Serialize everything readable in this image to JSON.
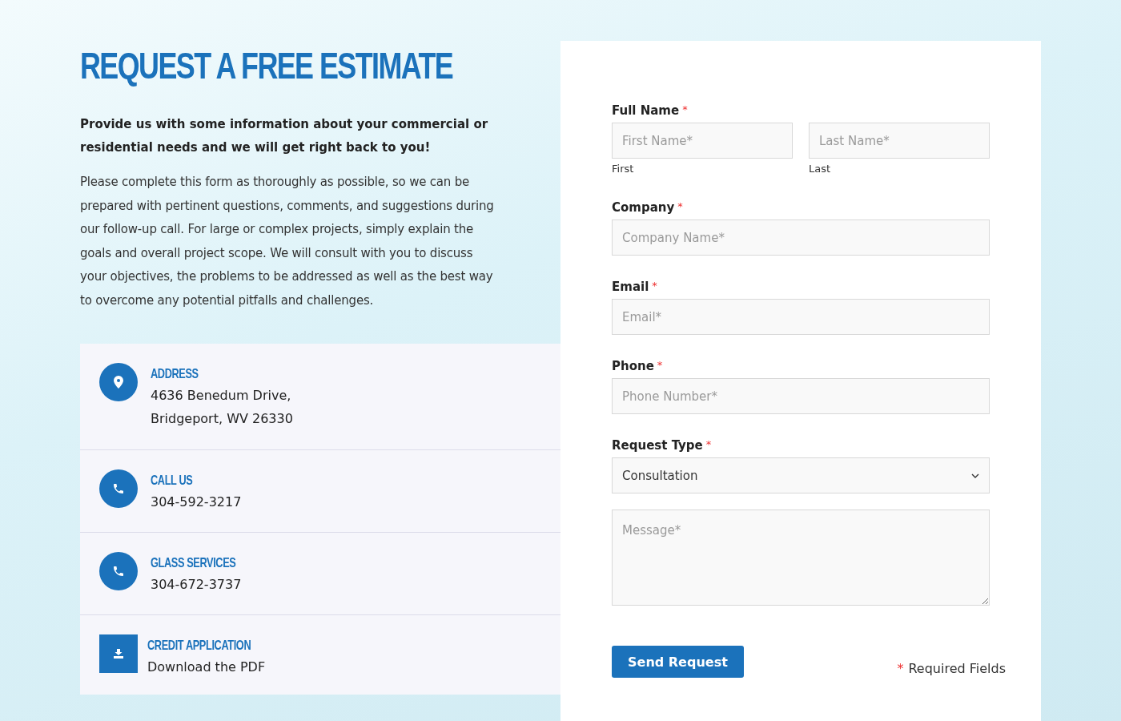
{
  "heading": "REQUEST A FREE ESTIMATE",
  "lead": "Provide us with some information about your commercial or residential needs and we will get right back to you!",
  "body": "Please complete this form as thoroughly as possible, so we can be prepared with pertinent questions, comments, and suggestions during our follow-up call. For large or complex projects, simply explain the goals and overall project scope. We will consult with you to discuss your objectives, the problems to be addressed as well as the best way to overcome any potential pitfalls and challenges.",
  "contacts": [
    {
      "kind": "location",
      "title": "ADDRESS",
      "lines": [
        "4636 Benedum Drive,",
        "Bridgeport, WV 26330"
      ]
    },
    {
      "kind": "phone",
      "title": "CALL US",
      "lines": [
        "304-592-3217"
      ]
    },
    {
      "kind": "phone",
      "title": "GLASS SERVICES",
      "lines": [
        "304-672-3737"
      ]
    },
    {
      "kind": "download",
      "title": "CREDIT APPLICATION",
      "lines": [
        "Download the PDF"
      ]
    }
  ],
  "form": {
    "fields": [
      {
        "kind": "name",
        "label": "Full Name",
        "required_mark": "*",
        "parts": [
          {
            "placeholder": "First Name*",
            "sublabel": "First"
          },
          {
            "placeholder": "Last Name*",
            "sublabel": "Last"
          }
        ]
      },
      {
        "kind": "text",
        "label": "Company",
        "required_mark": "*",
        "placeholder": "Company Name*"
      },
      {
        "kind": "text",
        "label": "Email",
        "required_mark": "*",
        "placeholder": "Email*"
      },
      {
        "kind": "text",
        "label": "Phone",
        "required_mark": "*",
        "placeholder": "Phone Number*"
      },
      {
        "kind": "select",
        "label": "Request Type",
        "required_mark": "*",
        "value": "Consultation"
      },
      {
        "kind": "textarea",
        "placeholder": "Message*"
      }
    ],
    "submit": "Send Request",
    "required_note": {
      "mark": "*",
      "text": "Required Fields"
    }
  }
}
